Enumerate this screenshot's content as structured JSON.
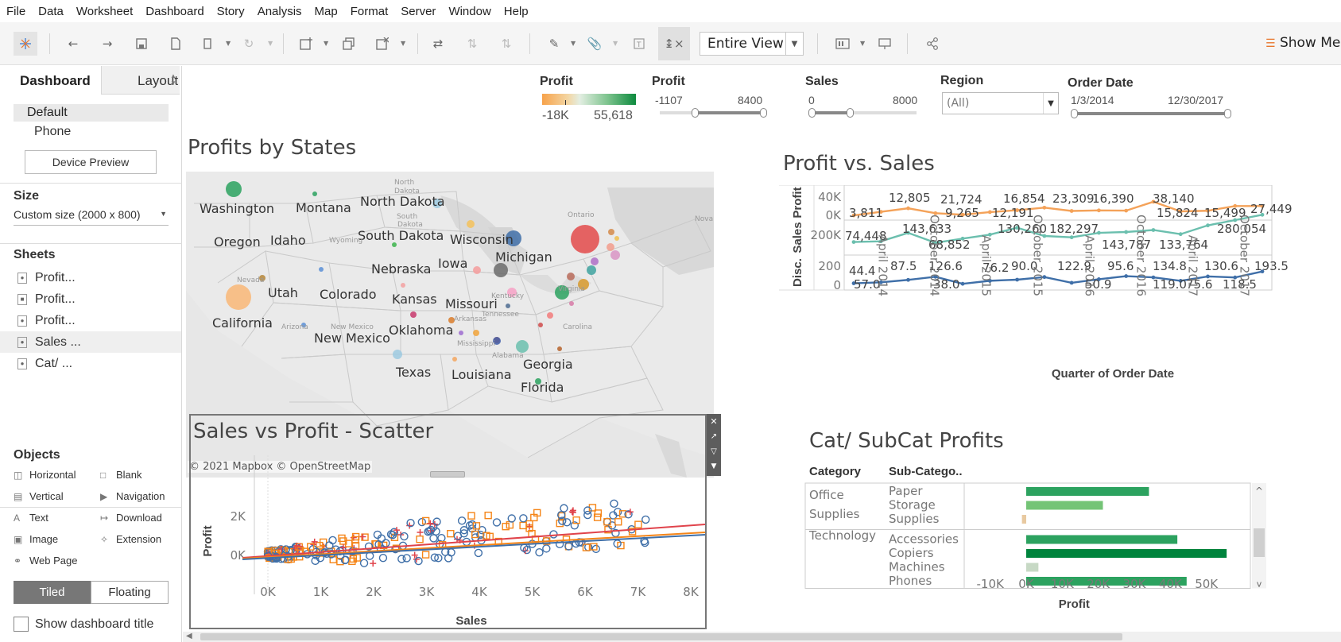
{
  "menu": [
    "File",
    "Data",
    "Worksheet",
    "Dashboard",
    "Story",
    "Analysis",
    "Map",
    "Format",
    "Server",
    "Window",
    "Help"
  ],
  "toolbar": {
    "fit_value": "Entire View",
    "show_me_label": "Show Me"
  },
  "left_panel": {
    "tabs": [
      "Dashboard",
      "Layout"
    ],
    "devices": [
      "Default",
      "Phone"
    ],
    "device_preview_label": "Device Preview",
    "size_title": "Size",
    "size_value": "Custom size (2000 x 800)",
    "sheets_title": "Sheets",
    "sheets": [
      "Profit...",
      "Profit...",
      "Profit...",
      "Sales ...",
      "Cat/ ..."
    ],
    "objects_title": "Objects",
    "objects": [
      "Horizontal",
      "Blank",
      "Vertical",
      "Navigation",
      "Text",
      "Download",
      "Image",
      "Extension",
      "Web Page"
    ],
    "layout_toggle": [
      "Tiled",
      "Floating"
    ],
    "show_title_label": "Show dashboard title"
  },
  "filters": {
    "profit_color": {
      "title": "Profit",
      "min": "-18K",
      "max": "55,618"
    },
    "profit_range": {
      "title": "Profit",
      "min": "-1107",
      "max": "8400"
    },
    "sales_range": {
      "title": "Sales",
      "min": "0",
      "max": "8000"
    },
    "region": {
      "title": "Region",
      "value": "(All)"
    },
    "order_date": {
      "title": "Order Date",
      "min": "1/3/2014",
      "max": "12/30/2017"
    }
  },
  "map": {
    "title": "Profits by States",
    "attribution": "© 2021 Mapbox © OpenStreetMap",
    "state_labels": [
      "Washington",
      "Montana",
      "North Dakota",
      "Oregon",
      "Idaho",
      "South Dakota",
      "Wisconsin",
      "Michigan",
      "Nebraska",
      "Iowa",
      "Utah",
      "Colorado",
      "Kansas",
      "Missouri",
      "California",
      "Oklahoma",
      "New Mexico",
      "Texas",
      "Louisiana",
      "Georgia",
      "Florida"
    ],
    "minor_labels": [
      "North",
      "Dakota",
      "South",
      "Dakota",
      "Wyoming",
      "Nevada",
      "Arizona",
      "New Mexico",
      "Arkansas",
      "Tennessee",
      "Kentucky",
      "Virginia",
      "Carolina",
      "Alabama",
      "Mississippi",
      "Ontario",
      "Nova"
    ],
    "colors": {
      "positive": "#2ca25f",
      "negative": "#f89a3a",
      "large_negative": "#e34a4a",
      "blue": "#3f6fa8"
    }
  },
  "line_chart": {
    "title": "Profit vs. Sales",
    "rows": [
      "Profit",
      "Sales",
      "Disc."
    ],
    "profit_ticks": [
      "40K",
      "0K"
    ],
    "sales_ticks": [
      "200K"
    ],
    "disc_ticks": [
      "200",
      "0"
    ],
    "xlabel": "Quarter of Order Date",
    "x_ticks": [
      "April 2014",
      "October 2014",
      "April 2015",
      "October 2015",
      "April 2016",
      "October 2016",
      "April 2017",
      "October 2017"
    ],
    "profit_labels": [
      "3,811",
      "12,805",
      "21,724",
      "9,265",
      "12,191",
      "16,854",
      "23,309",
      "16,390",
      "38,140",
      "15,824",
      "15,499",
      "27,449"
    ],
    "sales_labels": [
      "74,448",
      "143,633",
      "68,852",
      "130,260",
      "182,297",
      "143,787",
      "133,764",
      "280,054"
    ],
    "disc_labels": [
      "44.4",
      "57.0",
      "87.5",
      "126.6",
      "38.0",
      "76.2",
      "90.0",
      "122.9",
      "50.9",
      "95.6",
      "134.8",
      "119.0",
      "75.6",
      "130.6",
      "118.5",
      "193.5"
    ],
    "colors": {
      "profit": "#f4a259",
      "sales": "#6bbfae",
      "disc": "#3f6fa8"
    }
  },
  "scatter": {
    "title": "Sales vs Profit - Scatter",
    "xlabel": "Sales",
    "ylabel": "Profit",
    "x_ticks": [
      "0K",
      "1K",
      "2K",
      "3K",
      "4K",
      "5K",
      "6K",
      "7K",
      "8K"
    ],
    "y_ticks": [
      "2K",
      "0K"
    ],
    "colors": {
      "blue": "#3f6fa8",
      "orange": "#f58518",
      "red": "#e0434b"
    }
  },
  "bar_chart": {
    "title": "Cat/ SubCat Profits",
    "col_headers": [
      "Category",
      "Sub-Catego.."
    ],
    "categories": [
      {
        "name": "Office Supplies",
        "lines": [
          "Office",
          "Supplies"
        ],
        "subcats": [
          "Paper",
          "Storage",
          "Supplies"
        ]
      },
      {
        "name": "Technology",
        "lines": [
          "Technology"
        ],
        "subcats": [
          "Accessories",
          "Copiers",
          "Machines",
          "Phones"
        ]
      }
    ],
    "xlabel": "Profit",
    "x_ticks": [
      "-10K",
      "0K",
      "10K",
      "20K",
      "30K",
      "40K",
      "50K"
    ],
    "chart_data": {
      "type": "bar",
      "categories": [
        "Paper",
        "Storage",
        "Supplies",
        "Accessories",
        "Copiers",
        "Machines",
        "Phones"
      ],
      "values": [
        34054,
        21279,
        -1189,
        41937,
        55618,
        3385,
        44516
      ],
      "xlabel": "Profit",
      "xlim": [
        -15000,
        60000
      ]
    },
    "colors": [
      "#2ca25f",
      "#74c476",
      "#e8c9a0",
      "#2ca25f",
      "#00843d",
      "#c7d9c5",
      "#2ca25f"
    ]
  }
}
